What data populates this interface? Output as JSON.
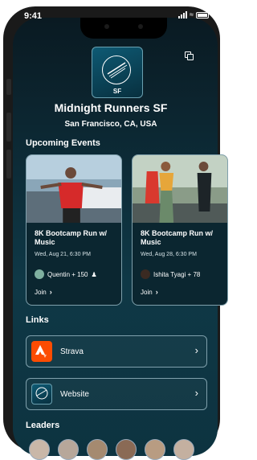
{
  "status": {
    "time": "9:41"
  },
  "club": {
    "logo_text": "SF",
    "name": "Midnight Runners SF",
    "location": "San Francisco, CA, USA"
  },
  "sections": {
    "events": "Upcoming Events",
    "links": "Links",
    "leaders": "Leaders"
  },
  "events": [
    {
      "title": "8K Bootcamp Run w/ Music",
      "date": "Wed, Aug 21, 6:30 PM",
      "attendees": "Quentin + 150",
      "join": "Join"
    },
    {
      "title": "8K Bootcamp Run w/ Music",
      "date": "Wed, Aug 28, 6:30 PM",
      "attendees": "Ishita Tyagi + 78",
      "join": "Join"
    }
  ],
  "links": [
    {
      "label": "Strava",
      "icon": "strava-icon",
      "color": "#fc4c02"
    },
    {
      "label": "Website",
      "icon": "website-icon",
      "color": "#0e5a74"
    }
  ],
  "colors": {
    "accent": "#0f3846",
    "strava": "#fc4c02"
  }
}
